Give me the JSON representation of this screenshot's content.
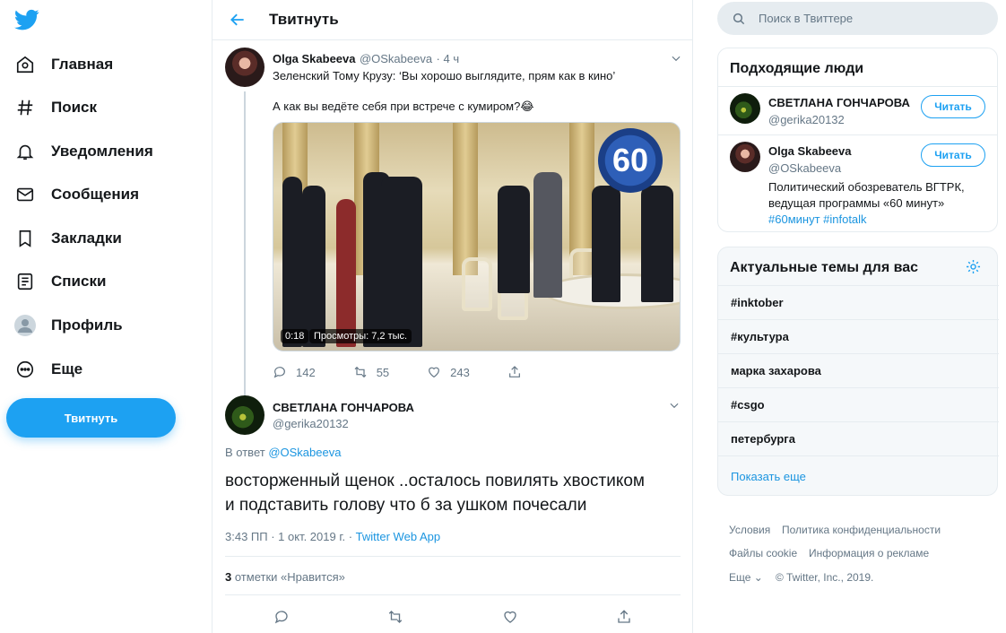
{
  "nav": {
    "items": [
      {
        "label": "Главная",
        "icon": "home-icon"
      },
      {
        "label": "Поиск",
        "icon": "hashtag-icon"
      },
      {
        "label": "Уведомления",
        "icon": "bell-icon"
      },
      {
        "label": "Сообщения",
        "icon": "mail-icon"
      },
      {
        "label": "Закладки",
        "icon": "bookmark-icon"
      },
      {
        "label": "Списки",
        "icon": "list-icon"
      },
      {
        "label": "Профиль",
        "icon": "avatar-icon"
      },
      {
        "label": "Еще",
        "icon": "more-icon"
      }
    ],
    "tweet_button": "Твитнуть"
  },
  "header": {
    "title": "Твитнуть"
  },
  "tweet": {
    "name": "Olga Skabeeva",
    "handle": "@OSkabeeva",
    "time": "· 4 ч",
    "line1": "Зеленский Тому Крузу: ‘Вы хорошо выглядите, прям как в кино’",
    "line2": "А как вы ведёте себя при встрече с кумиром?😂",
    "video_time": "0:18",
    "video_views": "Просмотры: 7,2 тыс.",
    "channel_badge": "60",
    "replies": "142",
    "retweets": "55",
    "likes": "243"
  },
  "reply": {
    "name": "СВЕТЛАНА ГОНЧАРОВА",
    "handle": "@gerika20132",
    "in_reply_prefix": "В ответ",
    "in_reply_handle": "@OSkabeeva",
    "text_line1": "восторженный щенок ..осталось повилять хвостиком",
    "text_line2": "и подставить голову что б за ушком почесали",
    "timestamp": "3:43 ПП · 1 окт. 2019 г. · ",
    "source": "Twitter Web App",
    "likes_count": "3",
    "likes_label": "отметки «Нравится»"
  },
  "search": {
    "placeholder": "Поиск в Твиттере"
  },
  "who_to_follow": {
    "title": "Подходящие люди",
    "users": [
      {
        "name": "СВЕТЛАНА ГОНЧАРОВА",
        "handle": "@gerika20132",
        "button": "Читать"
      },
      {
        "name": "Olga Skabeeva",
        "handle": "@OSkabeeva",
        "button": "Читать",
        "bio1": "Политический обозреватель ВГТРК,",
        "bio2": "ведущая программы «60 минут»",
        "tags": "#60минут #infotalk"
      }
    ]
  },
  "trends": {
    "title": "Актуальные темы для вас",
    "items": [
      "#inktober",
      "#культура",
      "марка захарова",
      "#csgo",
      "петербурга"
    ],
    "show_more": "Показать еще"
  },
  "footer": {
    "links": [
      "Условия",
      "Политика конфиденциальности",
      "Файлы cookie",
      "Информация о рекламе",
      "Еще ⌄",
      "© Twitter, Inc., 2019."
    ]
  },
  "colors": {
    "accent": "#1da1f2",
    "text": "#14171a",
    "muted": "#657786",
    "border": "#e6ecf0"
  }
}
